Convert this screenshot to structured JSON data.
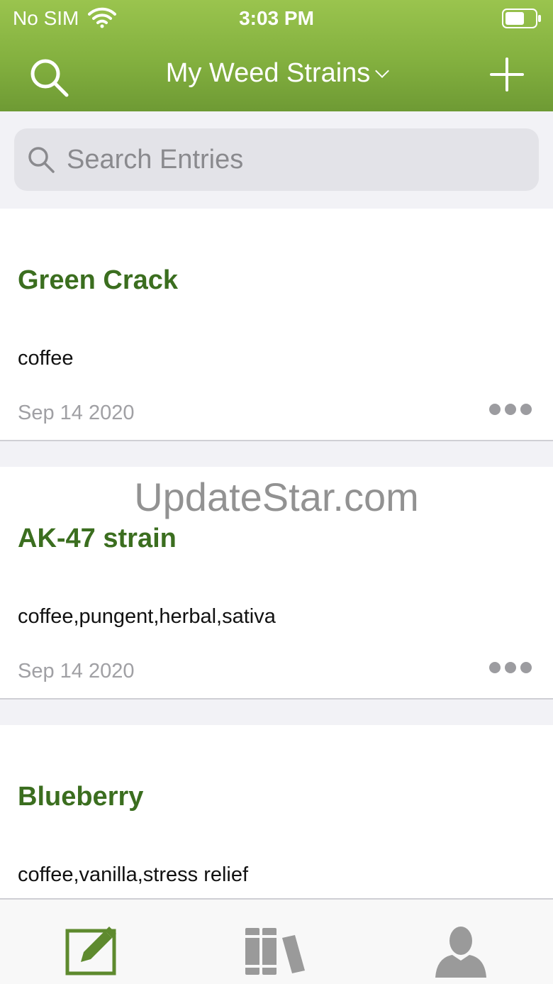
{
  "status_bar": {
    "carrier": "No SIM",
    "time": "3:03 PM"
  },
  "nav": {
    "title": "My Weed Strains"
  },
  "search": {
    "placeholder": "Search Entries",
    "value": ""
  },
  "entries": [
    {
      "title": "Green Crack",
      "tags": "coffee",
      "date": "Sep 14 2020"
    },
    {
      "title": "AK-47 strain",
      "tags": "coffee,pungent,herbal,sativa",
      "date": "Sep 14 2020"
    },
    {
      "title": "Blueberry",
      "tags": "coffee,vanilla,stress relief",
      "date": ""
    }
  ],
  "watermark": "UpdateStar.com",
  "tabs": [
    "entries",
    "library",
    "profile"
  ],
  "colors": {
    "header_green": "#8ab845",
    "title_green": "#3b6e1f",
    "tab_active": "#5e8a2e",
    "tab_inactive": "#9a9a9a"
  }
}
